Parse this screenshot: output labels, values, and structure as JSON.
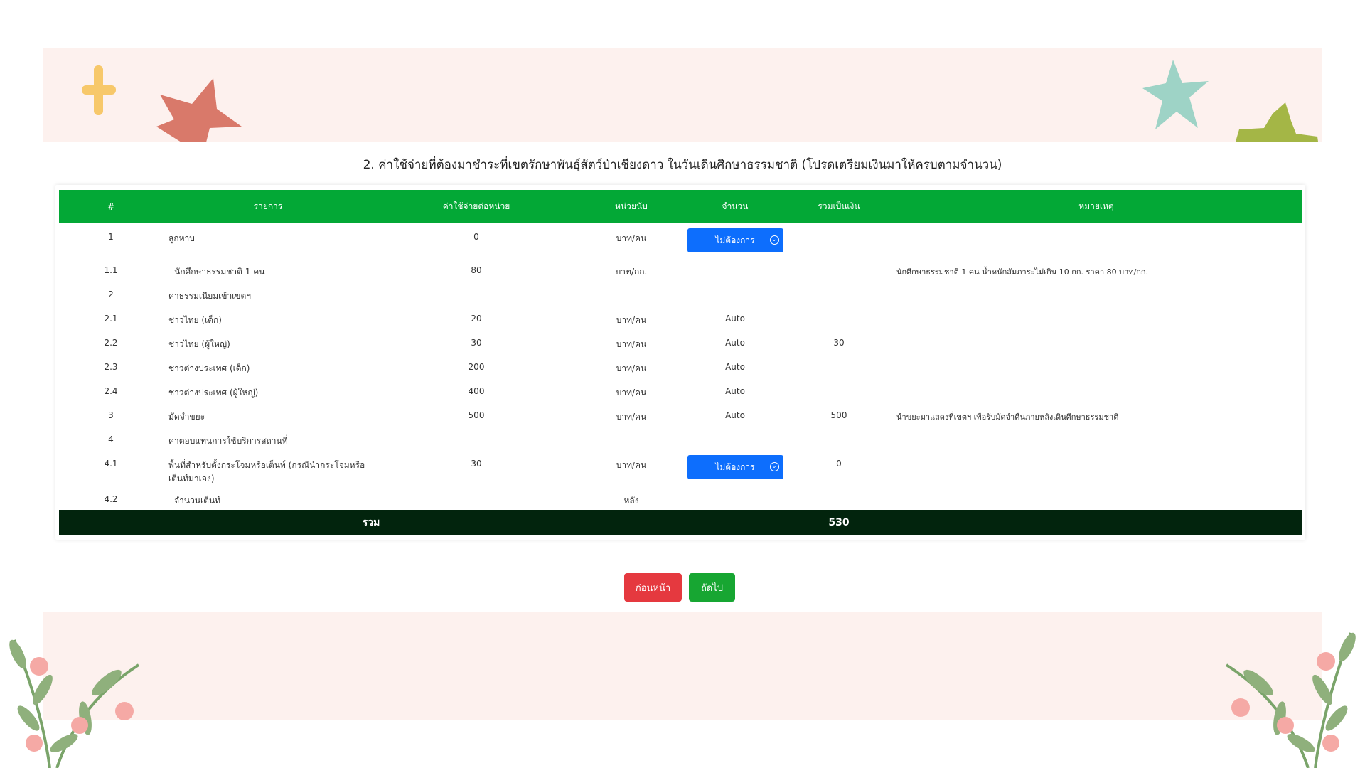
{
  "page": {
    "section_title": "2. ค่าใช้จ่ายที่ต้องมาชำระที่เขตรักษาพันธุ์สัตว์ป่าเชียงดาว ในวันเดินศึกษาธรรมชาติ (โปรดเตรียมเงินมาให้ครบตามจำนวน)"
  },
  "table": {
    "headers": [
      "#",
      "รายการ",
      "ค่าใช้จ่ายต่อหน่วย",
      "หน่วยนับ",
      "จำนวน",
      "รวมเป็นเงิน",
      "หมายเหตุ"
    ],
    "rows": [
      {
        "no": "1",
        "item": "ลูกหาบ",
        "unit_cost": "0",
        "unit": "บาท/คน",
        "qty": "ไม่ต้องการ",
        "qty_is_select": true,
        "total": "",
        "note": ""
      },
      {
        "no": "1.1",
        "item": "- นักศึกษาธรรมชาติ 1 คน",
        "unit_cost": "80",
        "unit": "บาท/กก.",
        "qty": "",
        "qty_is_select": false,
        "total": "",
        "note": "นักศึกษาธรรมชาติ 1 คน น้ำหนักสัมภาระไม่เกิน 10 กก. ราคา 80 บาท/กก."
      },
      {
        "no": "2",
        "item": "ค่าธรรมเนียมเข้าเขตฯ",
        "unit_cost": "",
        "unit": "",
        "qty": "",
        "qty_is_select": false,
        "total": "",
        "note": ""
      },
      {
        "no": "2.1",
        "item": "ชาวไทย (เด็ก)",
        "unit_cost": "20",
        "unit": "บาท/คน",
        "qty": "Auto",
        "qty_is_select": false,
        "total": "",
        "note": ""
      },
      {
        "no": "2.2",
        "item": "ชาวไทย (ผู้ใหญ่)",
        "unit_cost": "30",
        "unit": "บาท/คน",
        "qty": "Auto",
        "qty_is_select": false,
        "total": "30",
        "note": ""
      },
      {
        "no": "2.3",
        "item": "ชาวต่างประเทศ (เด็ก)",
        "unit_cost": "200",
        "unit": "บาท/คน",
        "qty": "Auto",
        "qty_is_select": false,
        "total": "",
        "note": ""
      },
      {
        "no": "2.4",
        "item": "ชาวต่างประเทศ (ผู้ใหญ่)",
        "unit_cost": "400",
        "unit": "บาท/คน",
        "qty": "Auto",
        "qty_is_select": false,
        "total": "",
        "note": ""
      },
      {
        "no": "3",
        "item": "มัดจำขยะ",
        "unit_cost": "500",
        "unit": "บาท/คน",
        "qty": "Auto",
        "qty_is_select": false,
        "total": "500",
        "note": "นำขยะมาแสดงที่เขตฯ เพื่อรับมัดจำคืนภายหลังเดินศึกษาธรรมชาติ"
      },
      {
        "no": "4",
        "item": "ค่าตอบแทนการใช้บริการสถานที่",
        "unit_cost": "",
        "unit": "",
        "qty": "",
        "qty_is_select": false,
        "total": "",
        "note": ""
      },
      {
        "no": "4.1",
        "item": "พื้นที่สำหรับตั้งกระโจมหรือเต็นท์ (กรณีนำกระโจมหรือเต็นท์มาเอง)",
        "unit_cost": "30",
        "unit": "บาท/คน",
        "qty": "ไม่ต้องการ",
        "qty_is_select": true,
        "total": "0",
        "note": ""
      },
      {
        "no": "4.2",
        "item": "- จำนวนเต็นท์",
        "unit_cost": "",
        "unit": "หลัง",
        "qty": "",
        "qty_is_select": false,
        "total": "",
        "note": ""
      }
    ],
    "footer_label": "รวม",
    "footer_total": "530"
  },
  "buttons": {
    "prev": "ก่อนหน้า",
    "next": "ถัดไป"
  },
  "colors": {
    "header_green": "#03a836",
    "footer_dark": "#02240d",
    "select_blue": "#0d6efd",
    "prev_red": "#e5393f",
    "next_green": "#17a632",
    "band_pink": "#fdf1ee"
  },
  "icons": [
    "plus-decoration-icon",
    "star-decoration-icon",
    "hill-decoration-icon",
    "plant-decoration-icon",
    "chevron-down-circle-icon"
  ]
}
